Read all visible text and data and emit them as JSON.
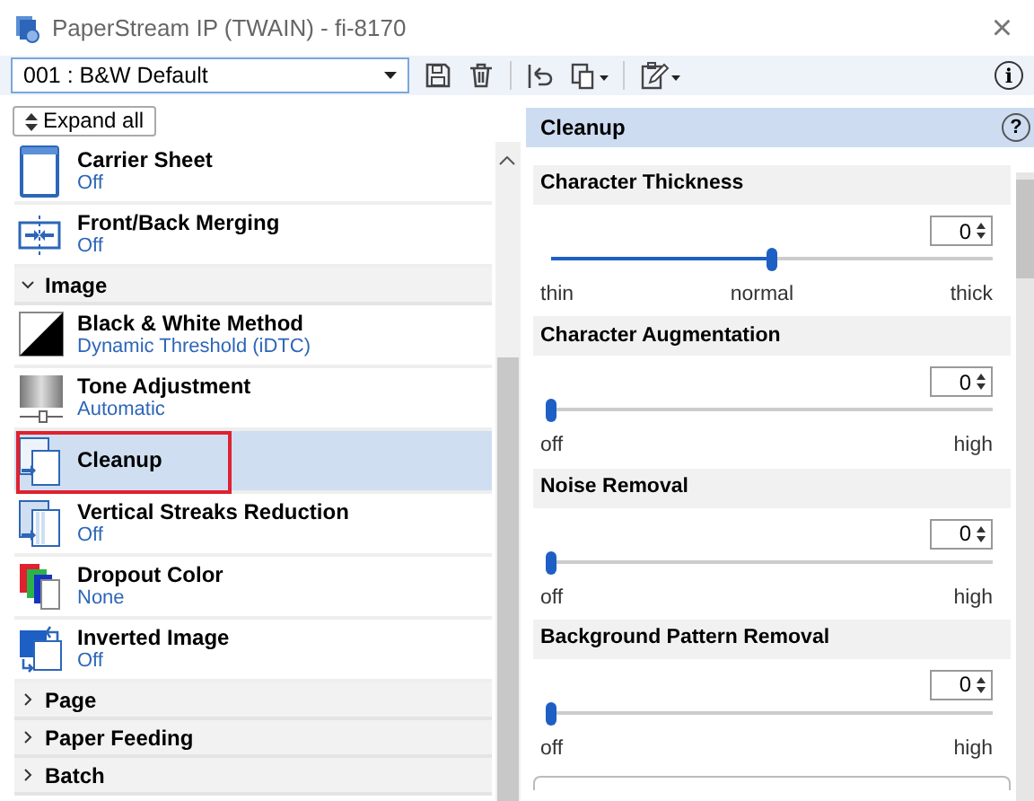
{
  "window": {
    "title": "PaperStream IP (TWAIN) - fi-8170",
    "close": "×"
  },
  "toolbar": {
    "profile": "001 : B&W Default",
    "info": "i"
  },
  "expand_button": "Expand all",
  "sidebar": {
    "items": [
      {
        "kind": "item",
        "title": "Carrier Sheet",
        "value": "Off",
        "selected": false,
        "highlighted": false
      },
      {
        "kind": "item",
        "title": "Front/Back Merging",
        "value": "Off",
        "selected": false,
        "highlighted": false
      },
      {
        "kind": "section",
        "title": "Image",
        "expanded": true
      },
      {
        "kind": "item",
        "title": "Black & White Method",
        "value": "Dynamic Threshold (iDTC)",
        "selected": false,
        "highlighted": false
      },
      {
        "kind": "item",
        "title": "Tone Adjustment",
        "value": "Automatic",
        "selected": false,
        "highlighted": false
      },
      {
        "kind": "item",
        "title": "Cleanup",
        "selected": true,
        "highlighted": true
      },
      {
        "kind": "item",
        "title": "Vertical Streaks Reduction",
        "value": "Off",
        "selected": false,
        "highlighted": false
      },
      {
        "kind": "item",
        "title": "Dropout Color",
        "value": "None",
        "selected": false,
        "highlighted": false
      },
      {
        "kind": "item",
        "title": "Inverted Image",
        "value": "Off",
        "selected": false,
        "highlighted": false
      },
      {
        "kind": "section",
        "title": "Page",
        "expanded": false
      },
      {
        "kind": "section",
        "title": "Paper Feeding",
        "expanded": false
      },
      {
        "kind": "section",
        "title": "Batch",
        "expanded": false
      }
    ]
  },
  "panel": {
    "title": "Cleanup",
    "help": "?",
    "settings": [
      {
        "title": "Character Thickness",
        "value": "0",
        "level": 0.5,
        "labels": [
          "thin",
          "normal",
          "thick"
        ]
      },
      {
        "title": "Character Augmentation",
        "value": "0",
        "level": 0,
        "labels": [
          "off",
          "high"
        ]
      },
      {
        "title": "Noise Removal",
        "value": "0",
        "level": 0,
        "labels": [
          "off",
          "high"
        ]
      },
      {
        "title": "Background Pattern Removal",
        "value": "0",
        "level": 0,
        "labels": [
          "off",
          "high"
        ]
      }
    ]
  }
}
